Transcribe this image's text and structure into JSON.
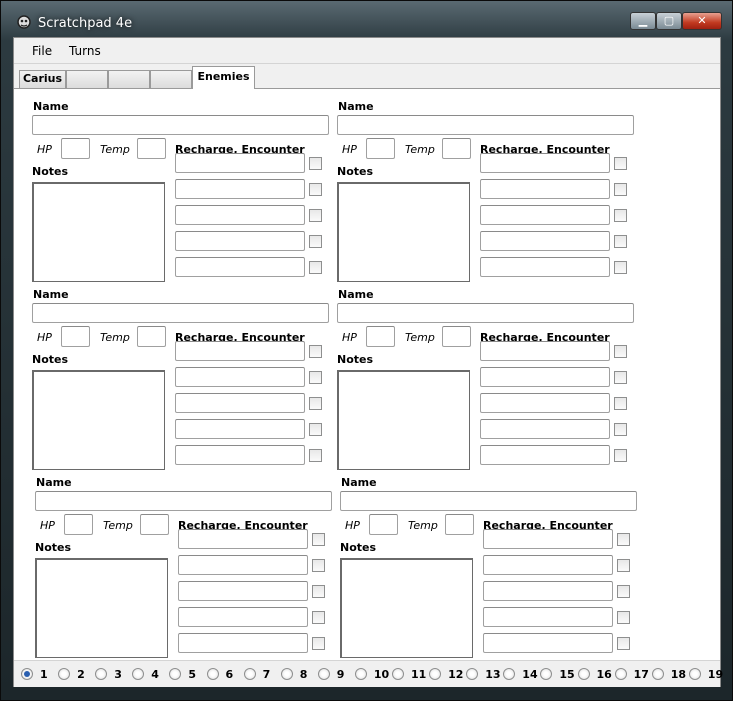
{
  "window": {
    "title": "Scratchpad 4e"
  },
  "menu": {
    "file": "File",
    "turns": "Turns"
  },
  "tabs": [
    {
      "label": "Carius",
      "active": false
    },
    {
      "label": "",
      "active": false
    },
    {
      "label": "",
      "active": false
    },
    {
      "label": "",
      "active": false
    },
    {
      "label": "Enemies",
      "active": true
    }
  ],
  "enemy_form": {
    "name_label": "Name",
    "hp_label": "HP",
    "temp_label": "Temp",
    "recharge_label": "Recharge, Encounter",
    "notes_label": "Notes"
  },
  "enemies": [
    {
      "name": "",
      "hp": "",
      "temp": "",
      "notes": ""
    },
    {
      "name": "",
      "hp": "",
      "temp": "",
      "notes": ""
    },
    {
      "name": "",
      "hp": "",
      "temp": "",
      "notes": ""
    },
    {
      "name": "",
      "hp": "",
      "temp": "",
      "notes": ""
    },
    {
      "name": "",
      "hp": "",
      "temp": "",
      "notes": ""
    },
    {
      "name": "",
      "hp": "",
      "temp": "",
      "notes": ""
    }
  ],
  "turn_selector": {
    "labels": [
      "1",
      "2",
      "3",
      "4",
      "5",
      "6",
      "7",
      "8",
      "9",
      "10",
      "11",
      "12",
      "13",
      "14",
      "15",
      "16",
      "17",
      "18",
      "19"
    ],
    "selected": "1"
  }
}
